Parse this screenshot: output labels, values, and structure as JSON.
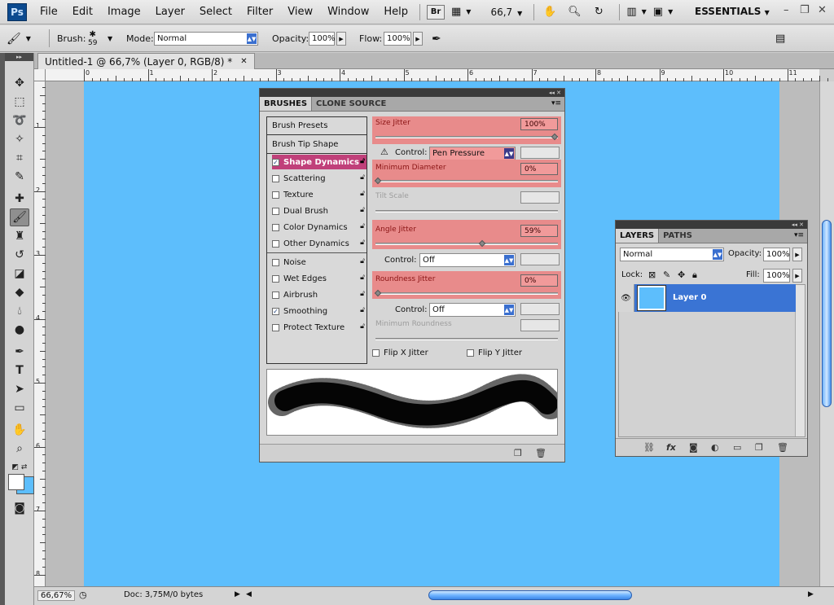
{
  "app": {
    "logo": "Ps",
    "workspace": "ESSENTIALS"
  },
  "menu": [
    "File",
    "Edit",
    "Image",
    "Layer",
    "Select",
    "Filter",
    "View",
    "Window",
    "Help"
  ],
  "appbar": {
    "bridge_label": "Br",
    "zoom": "66,7"
  },
  "options": {
    "brush_label": "Brush:",
    "brush_size": "59",
    "mode_label": "Mode:",
    "mode_value": "Normal",
    "opacity_label": "Opacity:",
    "opacity_value": "100%",
    "flow_label": "Flow:",
    "flow_value": "100%"
  },
  "document": {
    "tab_title": "Untitled-1 @ 66,7% (Layer 0, RGB/8) *",
    "ruler_h": [
      "0",
      "1",
      "2",
      "3",
      "4",
      "5",
      "6",
      "7",
      "8",
      "9",
      "10",
      "11"
    ],
    "ruler_v": [
      "1",
      "2",
      "3",
      "4",
      "5",
      "6",
      "7",
      "8"
    ],
    "zoom_status": "66,67%",
    "doc_info": "Doc: 3,75M/0 bytes"
  },
  "brushes_panel": {
    "tabs": [
      "BRUSHES",
      "CLONE SOURCE"
    ],
    "presets": "Brush Presets",
    "tip_shape": "Brush Tip Shape",
    "options": [
      {
        "label": "Shape Dynamics",
        "checked": true,
        "highlight": true
      },
      {
        "label": "Scattering",
        "checked": false
      },
      {
        "label": "Texture",
        "checked": false
      },
      {
        "label": "Dual Brush",
        "checked": false
      },
      {
        "label": "Color Dynamics",
        "checked": false
      },
      {
        "label": "Other Dynamics",
        "checked": false
      },
      {
        "label": "Noise",
        "checked": false
      },
      {
        "label": "Wet Edges",
        "checked": false
      },
      {
        "label": "Airbrush",
        "checked": false
      },
      {
        "label": "Smoothing",
        "checked": true
      },
      {
        "label": "Protect Texture",
        "checked": false
      }
    ],
    "size_jitter": {
      "label": "Size Jitter",
      "value": "100%",
      "level": 1.0
    },
    "control1": {
      "label": "Control:",
      "value": "Pen Pressure"
    },
    "min_diameter": {
      "label": "Minimum Diameter",
      "value": "0%",
      "level": 0.0
    },
    "tilt_scale": "Tilt Scale",
    "angle_jitter": {
      "label": "Angle Jitter",
      "value": "59%",
      "level": 0.59
    },
    "control2": {
      "label": "Control:",
      "value": "Off"
    },
    "roundness_jitter": {
      "label": "Roundness Jitter",
      "value": "0%",
      "level": 0.0
    },
    "control3": {
      "label": "Control:",
      "value": "Off"
    },
    "min_roundness": "Minimum Roundness",
    "flip_x": "Flip X Jitter",
    "flip_y": "Flip Y Jitter"
  },
  "layers_panel": {
    "tabs": [
      "LAYERS",
      "PATHS"
    ],
    "blend_mode": "Normal",
    "opacity_label": "Opacity:",
    "opacity_value": "100%",
    "lock_label": "Lock:",
    "fill_label": "Fill:",
    "fill_value": "100%",
    "layers": [
      {
        "name": "Layer 0",
        "visible": true
      }
    ]
  },
  "colors": {
    "canvas": "#5dbefc",
    "highlight": "#e88b8b",
    "selection": "#3a74d4",
    "dynamics_highlight": "#c0407a"
  }
}
